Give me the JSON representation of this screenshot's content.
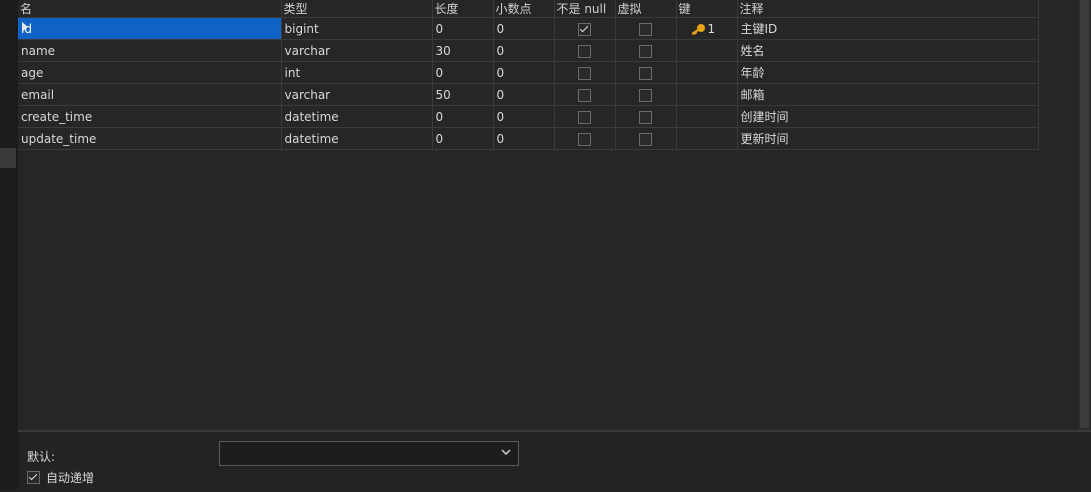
{
  "table": {
    "headers": [
      "名",
      "类型",
      "长度",
      "小数点",
      "不是 null",
      "虚拟",
      "键",
      "注释"
    ],
    "rows": [
      {
        "name": "id",
        "type": "bigint",
        "length": "0",
        "decimals": "0",
        "not_null": true,
        "virtual": false,
        "key": "1",
        "comment": "主键ID"
      },
      {
        "name": "name",
        "type": "varchar",
        "length": "30",
        "decimals": "0",
        "not_null": false,
        "virtual": false,
        "key": "",
        "comment": "姓名"
      },
      {
        "name": "age",
        "type": "int",
        "length": "0",
        "decimals": "0",
        "not_null": false,
        "virtual": false,
        "key": "",
        "comment": "年龄"
      },
      {
        "name": "email",
        "type": "varchar",
        "length": "50",
        "decimals": "0",
        "not_null": false,
        "virtual": false,
        "key": "",
        "comment": "邮箱"
      },
      {
        "name": "create_time",
        "type": "datetime",
        "length": "0",
        "decimals": "0",
        "not_null": false,
        "virtual": false,
        "key": "",
        "comment": "创建时间"
      },
      {
        "name": "update_time",
        "type": "datetime",
        "length": "0",
        "decimals": "0",
        "not_null": false,
        "virtual": false,
        "key": "",
        "comment": "更新时间"
      }
    ]
  },
  "bottom": {
    "default_label": "默认:",
    "default_value": "",
    "auto_increment_label": "自动递增",
    "auto_increment_checked": true
  },
  "colors": {
    "selection": "#0e63c4",
    "key_icon": "#e8a317"
  },
  "icons": {
    "key": "key-icon",
    "row_marker": "row-pointer-icon",
    "dropdown": "chevron-down-icon"
  }
}
